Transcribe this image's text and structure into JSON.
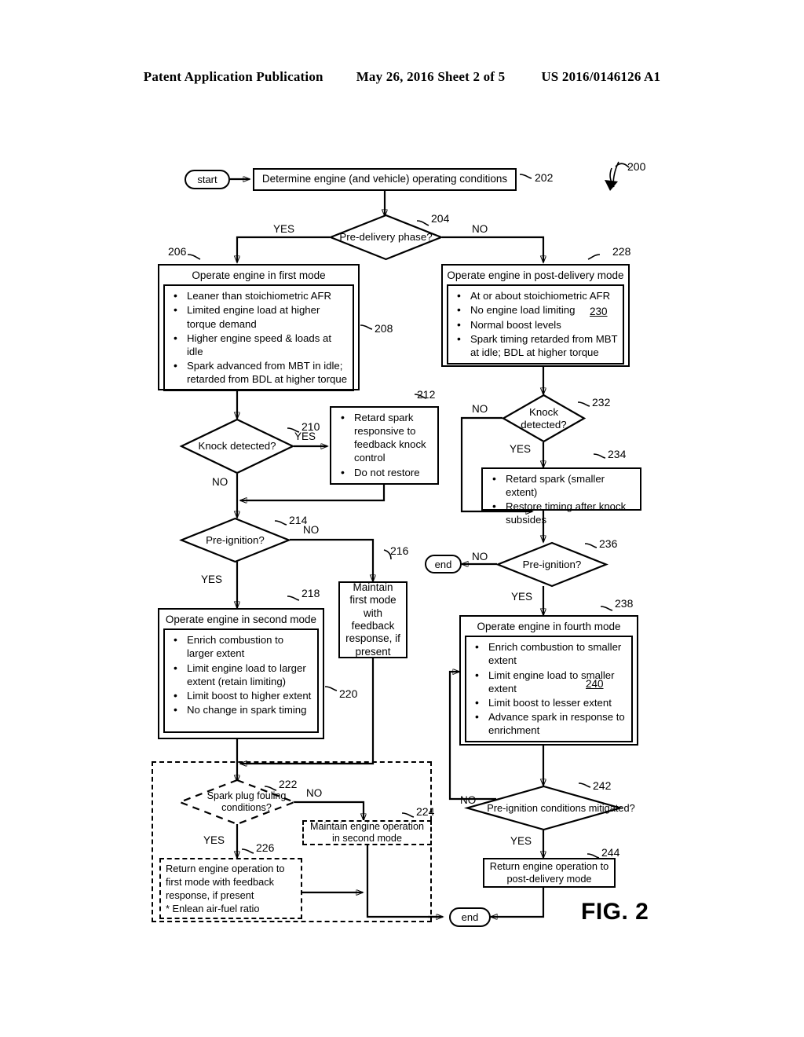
{
  "header": {
    "title": "Patent Application Publication",
    "date_sheet": "May 26, 2016  Sheet 2 of 5",
    "publication_number": "US 2016/0146126 A1"
  },
  "figure": {
    "label": "FIG. 2",
    "flow_ref": "200"
  },
  "terminals": {
    "start": "start",
    "end_mid": "end",
    "end_bottom": "end"
  },
  "nodes": {
    "n202": {
      "ref": "202",
      "text": "Determine engine (and vehicle) operating conditions"
    },
    "n204": {
      "ref": "204",
      "text": "Pre-delivery phase?",
      "yes": "YES",
      "no": "NO"
    },
    "n206": {
      "ref": "206",
      "inner_ref": "208",
      "title": "Operate engine in first mode",
      "bullets": [
        "Leaner than stoichiometric AFR",
        "Limited engine load at higher torque demand",
        "Higher engine speed & loads at idle",
        "Spark advanced from MBT in idle; retarded from BDL at higher torque"
      ]
    },
    "n228": {
      "ref": "228",
      "inner_ref": "230",
      "title": "Operate engine in post-delivery mode",
      "bullets": [
        "At or about stoichiometric AFR",
        "No engine load limiting",
        "Normal boost levels",
        "Spark timing retarded from MBT at idle; BDL at higher torque"
      ]
    },
    "n210": {
      "ref": "210",
      "text": "Knock detected?",
      "yes": "YES",
      "no": "NO"
    },
    "n212": {
      "ref": "212",
      "bullets": [
        "Retard spark responsive to feedback knock control",
        "Do not restore"
      ]
    },
    "n232": {
      "ref": "232",
      "text": "Knock detected?",
      "yes": "YES",
      "no": "NO"
    },
    "n234": {
      "ref": "234",
      "bullets": [
        "Retard spark (smaller extent)",
        "Restore timing after knock subsides"
      ]
    },
    "n214": {
      "ref": "214",
      "text": "Pre-ignition?",
      "yes": "YES",
      "no": "NO"
    },
    "n216": {
      "ref": "216",
      "text": "Maintain first mode with feedback response, if present"
    },
    "n236": {
      "ref": "236",
      "text": "Pre-ignition?",
      "yes": "YES",
      "no": "NO"
    },
    "n218": {
      "ref": "218",
      "inner_ref": "220",
      "title": "Operate engine in second mode",
      "bullets": [
        "Enrich combustion to larger extent",
        "Limit engine load to larger extent (retain limiting)",
        "Limit boost to higher extent",
        "No change in spark timing"
      ]
    },
    "n238": {
      "ref": "238",
      "inner_ref": "240",
      "title": "Operate engine in fourth mode",
      "bullets": [
        "Enrich combustion to smaller extent",
        "Limit engine load to smaller extent",
        "Limit boost to lesser extent",
        "Advance spark in response to enrichment"
      ]
    },
    "n222": {
      "ref": "222",
      "text": "Spark plug fouling conditions?",
      "yes": "YES",
      "no": "NO"
    },
    "n224": {
      "ref": "224",
      "text": "Maintain engine operation in second mode"
    },
    "n226": {
      "ref": "226",
      "lines": [
        "Return engine operation to",
        "first mode with feedback",
        "response, if present",
        "* Enlean air-fuel ratio"
      ]
    },
    "n242": {
      "ref": "242",
      "text": "Pre-ignition conditions mitigated?",
      "yes": "YES",
      "no": "NO"
    },
    "n244": {
      "ref": "244",
      "text": "Return engine operation to post-delivery mode"
    }
  },
  "colors": {
    "ink": "#000000",
    "paper": "#ffffff"
  }
}
